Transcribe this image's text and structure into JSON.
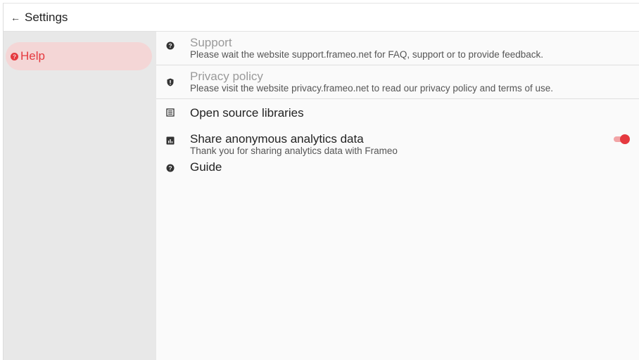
{
  "header": {
    "back_icon": "arrow-left-icon",
    "title": "Settings"
  },
  "sidebar": {
    "items": [
      {
        "label": "Help",
        "icon": "help-circle-icon",
        "selected": true
      }
    ]
  },
  "main": {
    "rows": [
      {
        "icon": "help-circle-icon",
        "title": "Support",
        "subtitle": "Please wait the website support.frameo.net for FAQ, support or to provide feedback."
      },
      {
        "icon": "shield-icon",
        "title": "Privacy policy",
        "subtitle": "Please visit the website privacy.frameo.net to read our privacy policy and terms of use."
      },
      {
        "icon": "list-document-icon",
        "title": "Open source libraries"
      },
      {
        "icon": "analytics-chart-icon",
        "title": "Share anonymous analytics data",
        "subtitle": "Thank you for sharing analytics data with Frameo",
        "toggle_on": true
      },
      {
        "icon": "help-circle-icon",
        "title": "Guide"
      }
    ]
  },
  "colors": {
    "accent": "#e5393f",
    "selected_bg": "#f4d6d6",
    "sidebar_bg": "#e8e8e8"
  }
}
